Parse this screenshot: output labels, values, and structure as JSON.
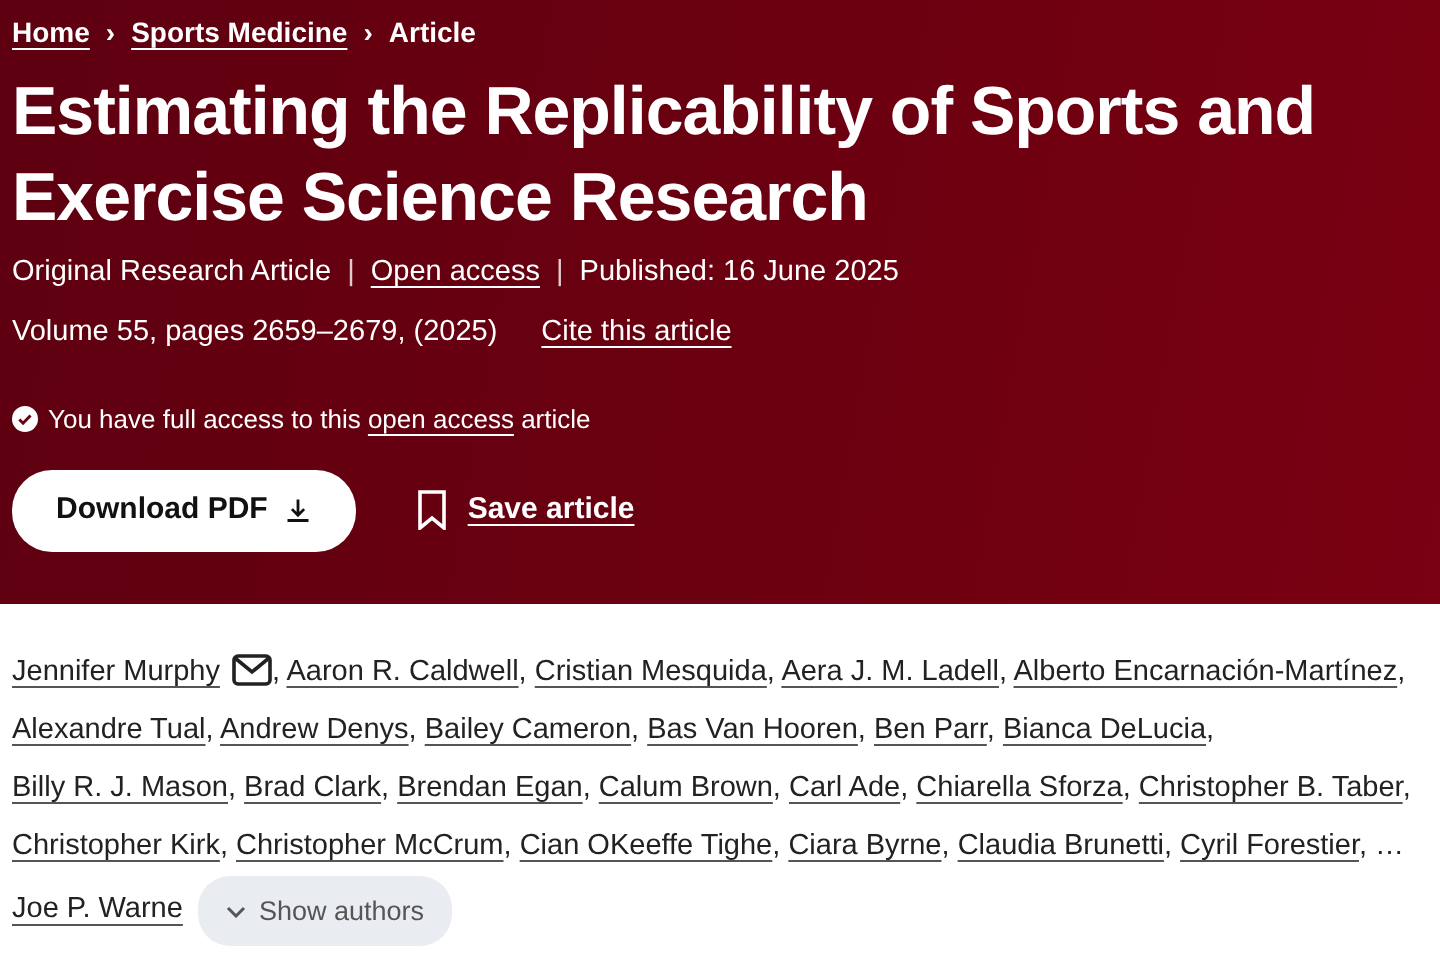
{
  "breadcrumb": [
    {
      "label": "Home",
      "link": true
    },
    {
      "label": "Sports Medicine",
      "link": true
    },
    {
      "label": "Article",
      "link": false
    }
  ],
  "breadcrumb_separator": "›",
  "title": "Estimating the Replicability of Sports and Exercise Science Research",
  "meta_line_1": [
    {
      "text": "Original Research Article",
      "link": false
    },
    {
      "text": "Open access",
      "link": true
    },
    {
      "text": "Published: 16 June 2025",
      "link": false
    }
  ],
  "meta_separator": "|",
  "meta_line_2": [
    {
      "text": "Volume 55, pages 2659–2679, (2025)",
      "link": false
    },
    {
      "text": "Cite this article",
      "link": true
    }
  ],
  "access_link": "open access",
  "access_before": "You have full access to this",
  "access_after": "article",
  "download_button": "Download PDF",
  "save_button": "Save article",
  "authors": [
    {
      "name": "Jennifer Murphy",
      "corresponding": true
    },
    {
      "name": "Aaron R. Caldwell",
      "corresponding": false
    },
    {
      "name": "Cristian Mesquida",
      "corresponding": false
    },
    {
      "name": "Aera J. M. Ladell",
      "corresponding": false
    },
    {
      "name": "Alberto Encarnación-Martínez",
      "corresponding": false
    },
    {
      "name": "Alexandre Tual",
      "corresponding": false
    },
    {
      "name": "Andrew Denys",
      "corresponding": false
    },
    {
      "name": "Bailey Cameron",
      "corresponding": false
    },
    {
      "name": "Bas Van Hooren",
      "corresponding": false
    },
    {
      "name": "Ben Parr",
      "corresponding": false
    },
    {
      "name": "Bianca DeLucia",
      "corresponding": false
    },
    {
      "name": "Billy R. J. Mason",
      "corresponding": false
    },
    {
      "name": "Brad Clark",
      "corresponding": false
    },
    {
      "name": "Brendan Egan",
      "corresponding": false
    },
    {
      "name": "Calum Brown",
      "corresponding": false
    },
    {
      "name": "Carl Ade",
      "corresponding": false
    },
    {
      "name": "Chiarella Sforza",
      "corresponding": false
    },
    {
      "name": "Christopher B. Taber",
      "corresponding": false
    },
    {
      "name": "Christopher Kirk",
      "corresponding": false
    },
    {
      "name": "Christopher McCrum",
      "corresponding": false
    },
    {
      "name": "Cian OKeeffe Tighe",
      "corresponding": false
    },
    {
      "name": "Ciara Byrne",
      "corresponding": false
    },
    {
      "name": "Claudia Brunetti",
      "corresponding": false
    },
    {
      "name": "Cyril Forestier",
      "corresponding": false
    }
  ],
  "author_separator": ",",
  "ellipsis": "…",
  "last_author": "Joe P. Warne",
  "show_authors_button": "Show authors"
}
